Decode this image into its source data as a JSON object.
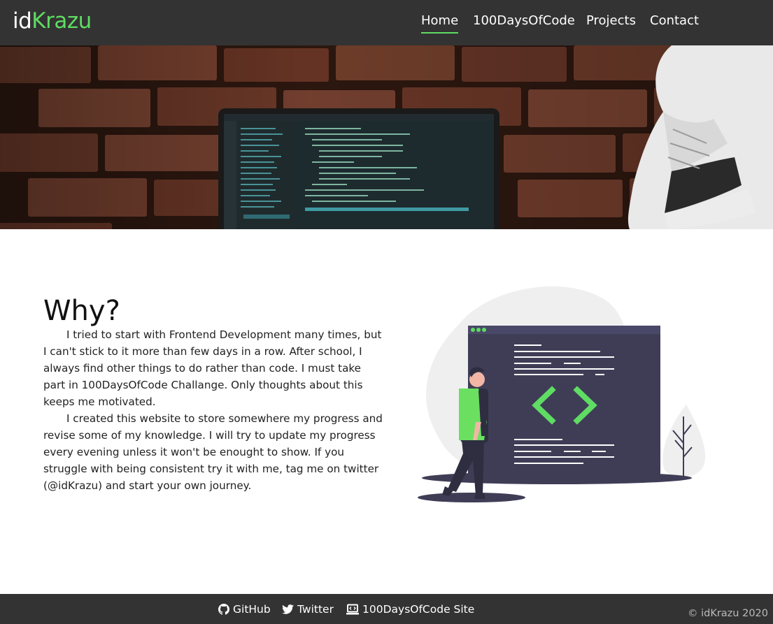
{
  "header": {
    "logo_prefix": "id",
    "logo_suffix": "Krazu",
    "nav": [
      {
        "label": "Home",
        "active": true
      },
      {
        "label": "100DaysOfCode",
        "active": false
      },
      {
        "label": "Projects",
        "active": false
      },
      {
        "label": "Contact",
        "active": false
      }
    ]
  },
  "main": {
    "title": "Why?",
    "paragraphs": [
      "I tried to start with Frontend Development many times, but I can't stick to it more than few days in a row. After school, I always find other things to do rather than code. I must take part in 100DaysOfCode Challange. Only thoughts about this keeps me motivated.",
      "I created this website to store somewhere my progress and revise some of my knowledge. I will try to update my progress every evening unless it won't be enought to show. If you struggle with being consistent try it with me, tag me on twitter (@idKrazu) and start your own journey."
    ]
  },
  "footer": {
    "links": [
      {
        "label": "GitHub",
        "icon": "github-icon"
      },
      {
        "label": "Twitter",
        "icon": "twitter-icon"
      },
      {
        "label": "100DaysOfCode Site",
        "icon": "laptop-icon"
      }
    ],
    "copyright": "© idKrazu 2020"
  },
  "colors": {
    "header_bg": "#333333",
    "accent": "#5fdc63",
    "illustration_dark": "#3f3d56"
  }
}
